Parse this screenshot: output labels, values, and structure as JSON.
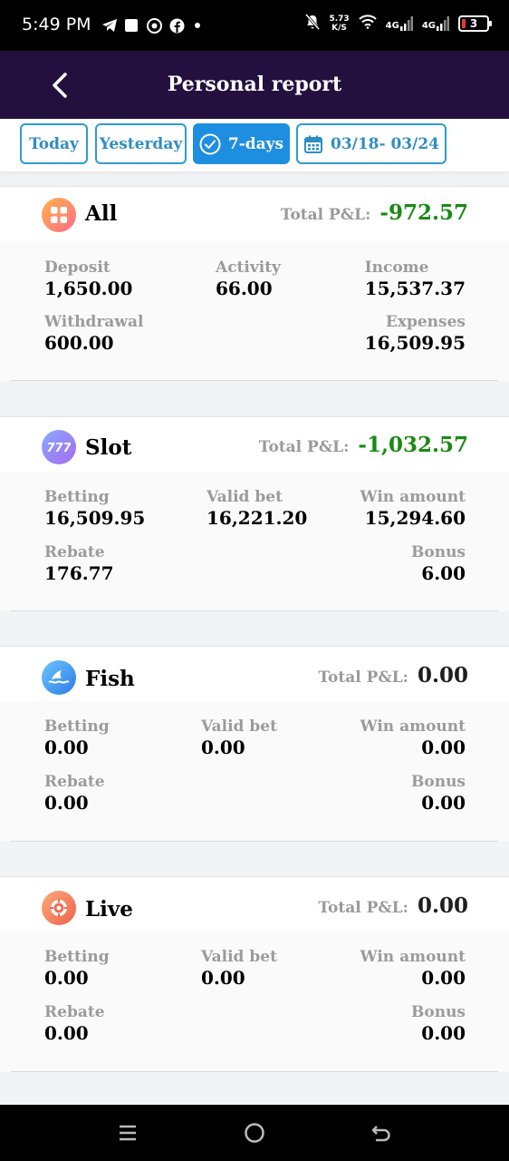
{
  "status_bar": {
    "time": "5:49 PM",
    "net_speed_value": "5.73",
    "net_speed_unit": "K/S",
    "signal1": "4G",
    "signal2": "4G",
    "battery": "3",
    "icons": [
      "telegram-icon",
      "square-notification-icon",
      "chrome-icon",
      "facebook-icon",
      "dot-icon",
      "mute-bell-icon",
      "wifi-icon"
    ]
  },
  "header": {
    "title": "Personal report"
  },
  "tabs": {
    "today": "Today",
    "yesterday": "Yesterday",
    "seven_days": "7-days",
    "date_range": "03/18- 03/24",
    "active": "7-days"
  },
  "colors": {
    "header_bg": "#23103f",
    "accent_blue": "#1e8fe0",
    "negative_green": "#1a8a12"
  },
  "all": {
    "name": "All",
    "pl_label": "Total P&L:",
    "pl_value": "-972.57",
    "deposit_label": "Deposit",
    "deposit_value": "1,650.00",
    "activity_label": "Activity",
    "activity_value": "66.00",
    "income_label": "Income",
    "income_value": "15,537.37",
    "withdrawal_label": "Withdrawal",
    "withdrawal_value": "600.00",
    "expenses_label": "Expenses",
    "expenses_value": "16,509.95"
  },
  "slot": {
    "name": "Slot",
    "pl_label": "Total P&L:",
    "pl_value": "-1,032.57",
    "betting_label": "Betting",
    "betting_value": "16,509.95",
    "valid_label": "Valid bet",
    "valid_value": "16,221.20",
    "win_label": "Win amount",
    "win_value": "15,294.60",
    "rebate_label": "Rebate",
    "rebate_value": "176.77",
    "bonus_label": "Bonus",
    "bonus_value": "6.00"
  },
  "fish": {
    "name": "Fish",
    "pl_label": "Total P&L:",
    "pl_value": "0.00",
    "betting_label": "Betting",
    "betting_value": "0.00",
    "valid_label": "Valid bet",
    "valid_value": "0.00",
    "win_label": "Win amount",
    "win_value": "0.00",
    "rebate_label": "Rebate",
    "rebate_value": "0.00",
    "bonus_label": "Bonus",
    "bonus_value": "0.00"
  },
  "live": {
    "name": "Live",
    "pl_label": "Total P&L:",
    "pl_value": "0.00",
    "betting_label": "Betting",
    "betting_value": "0.00",
    "valid_label": "Valid bet",
    "valid_value": "0.00",
    "win_label": "Win amount",
    "win_value": "0.00",
    "rebate_label": "Rebate",
    "rebate_value": "0.00",
    "bonus_label": "Bonus",
    "bonus_value": "0.00"
  }
}
